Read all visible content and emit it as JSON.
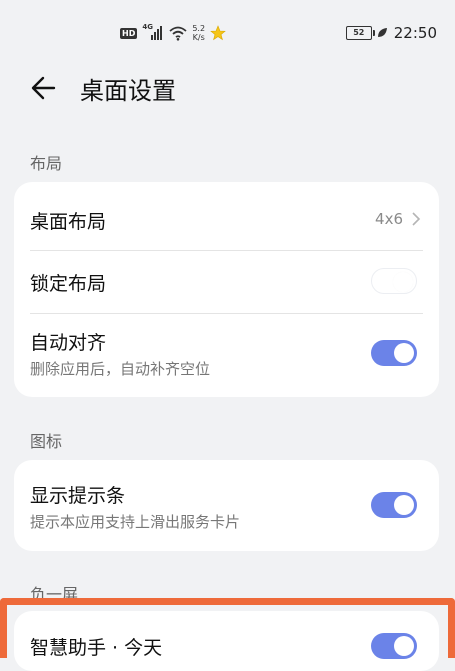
{
  "status": {
    "hd": "HD",
    "network": "4G",
    "speed_value": "5.2",
    "speed_unit": "K/s",
    "battery": "52",
    "time": "22:50"
  },
  "header": {
    "title": "桌面设置"
  },
  "sections": {
    "layout": {
      "label": "布局"
    },
    "icons": {
      "label": "图标"
    },
    "minus_one": {
      "label": "负一屏"
    }
  },
  "rows": {
    "desktop_layout": {
      "title": "桌面布局",
      "value": "4x6"
    },
    "lock_layout": {
      "title": "锁定布局",
      "enabled": false
    },
    "auto_align": {
      "title": "自动对齐",
      "subtitle": "删除应用后，自动补齐空位",
      "enabled": true
    },
    "show_hint_bar": {
      "title": "显示提示条",
      "subtitle": "提示本应用支持上滑出服务卡片",
      "enabled": true
    },
    "smart_assistant": {
      "title": "智慧助手 · 今天",
      "enabled": true
    }
  },
  "colors": {
    "accent": "#6b83e8",
    "highlight": "#ee6a3a",
    "background": "#f1f2f4"
  }
}
